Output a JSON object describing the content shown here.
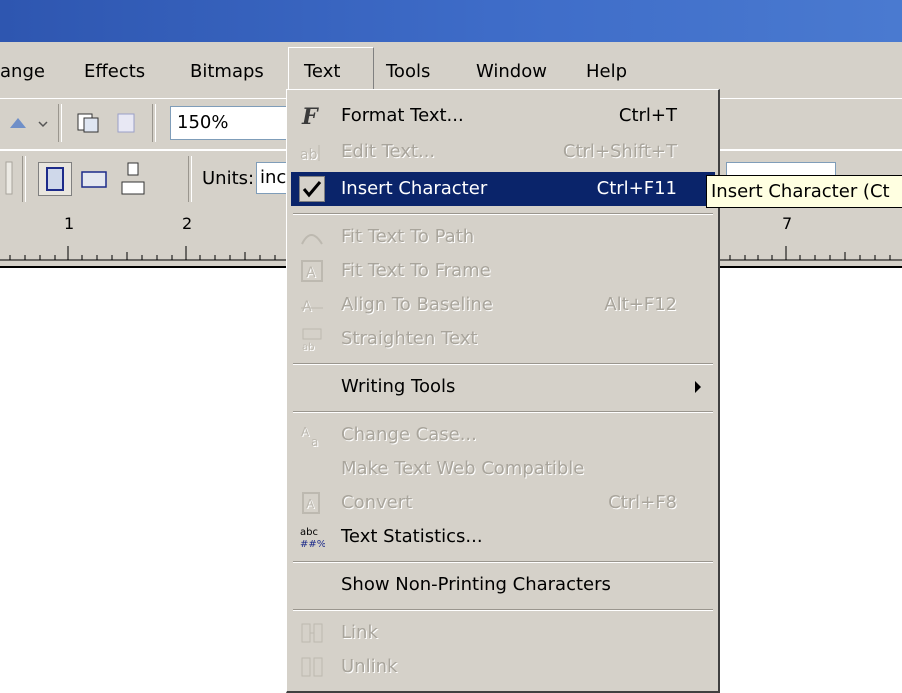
{
  "menubar": {
    "items": [
      {
        "label": "ange",
        "id": "arrange"
      },
      {
        "label": "Effects",
        "id": "effects"
      },
      {
        "label": "Bitmaps",
        "id": "bitmaps"
      },
      {
        "label": "Text",
        "id": "text"
      },
      {
        "label": "Tools",
        "id": "tools"
      },
      {
        "label": "Window",
        "id": "window"
      },
      {
        "label": "Help",
        "id": "help"
      }
    ]
  },
  "toolbar": {
    "zoom_value": "150%",
    "units_label": "Units:",
    "units_value": "inc"
  },
  "ruler": {
    "ticks": [
      "1",
      "2",
      "7"
    ]
  },
  "text_menu": {
    "items": [
      {
        "label": "Format Text...",
        "shortcut": "Ctrl+T",
        "icon": "format-text-icon",
        "enabled": true
      },
      {
        "label": "Edit Text...",
        "shortcut": "Ctrl+Shift+T",
        "icon": "edit-text-icon",
        "enabled": false
      },
      {
        "label": "Insert Character",
        "shortcut": "Ctrl+F11",
        "icon": "checkmark-icon",
        "enabled": true,
        "highlighted": true
      },
      {
        "label": "Fit Text To Path",
        "shortcut": "",
        "icon": "fit-path-icon",
        "enabled": false
      },
      {
        "label": "Fit Text To Frame",
        "shortcut": "",
        "icon": "fit-frame-icon",
        "enabled": false
      },
      {
        "label": "Align To Baseline",
        "shortcut": "Alt+F12",
        "icon": "align-baseline-icon",
        "enabled": false
      },
      {
        "label": "Straighten Text",
        "shortcut": "",
        "icon": "straighten-text-icon",
        "enabled": false
      },
      {
        "label": "Writing Tools",
        "shortcut": "",
        "icon": "",
        "enabled": true,
        "submenu": true
      },
      {
        "label": "Change Case...",
        "shortcut": "",
        "icon": "change-case-icon",
        "enabled": false
      },
      {
        "label": "Make Text Web Compatible",
        "shortcut": "",
        "icon": "",
        "enabled": false
      },
      {
        "label": "Convert",
        "shortcut": "Ctrl+F8",
        "icon": "convert-icon",
        "enabled": false
      },
      {
        "label": "Text Statistics...",
        "shortcut": "",
        "icon": "text-statistics-icon",
        "enabled": true
      },
      {
        "label": "Show Non-Printing Characters",
        "shortcut": "",
        "icon": "",
        "enabled": true
      },
      {
        "label": "Link",
        "shortcut": "",
        "icon": "link-icon",
        "enabled": false
      },
      {
        "label": "Unlink",
        "shortcut": "",
        "icon": "unlink-icon",
        "enabled": false
      }
    ]
  },
  "tooltip": {
    "text": "Insert Character (Ct"
  },
  "colors": {
    "highlight": "#0a246a",
    "menu_bg": "#d5d1c9",
    "titlebar": "#3e6cc8",
    "tooltip_bg": "#ffffe1"
  }
}
